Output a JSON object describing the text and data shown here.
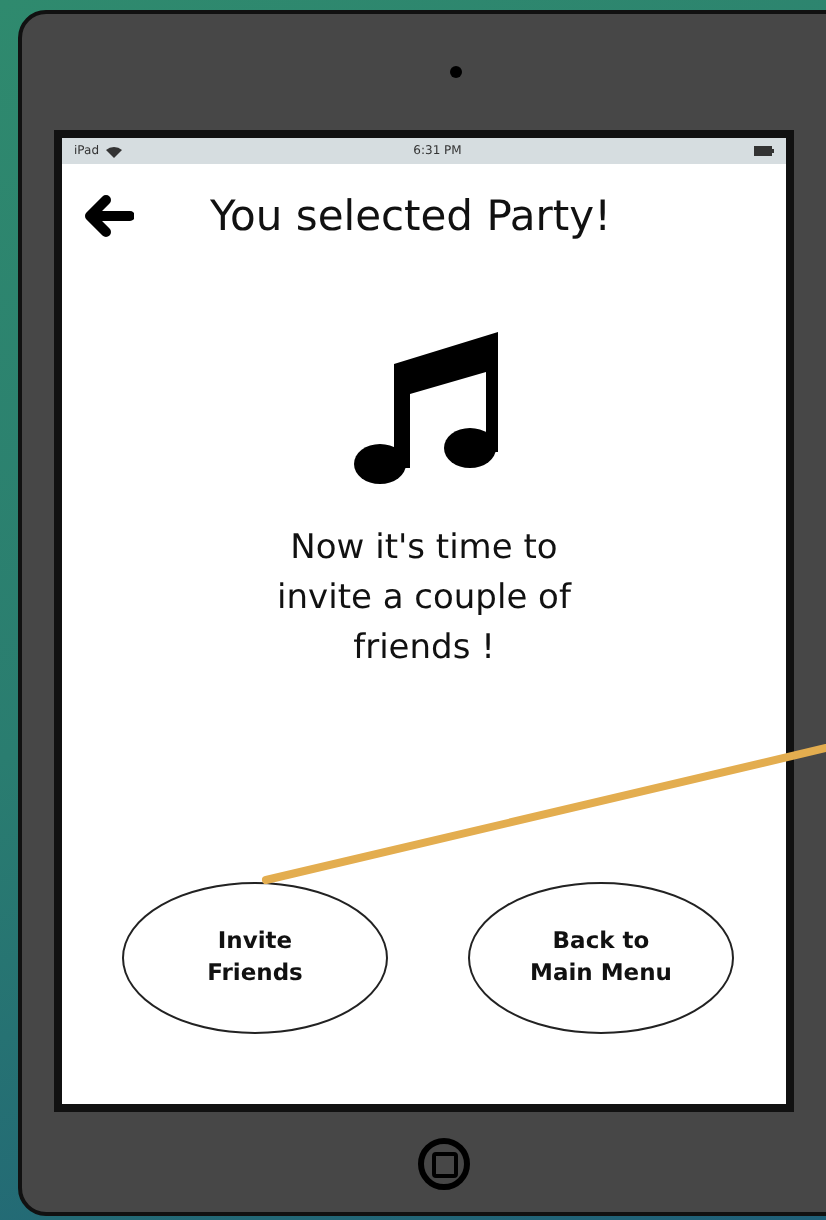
{
  "status_bar": {
    "device": "iPad",
    "time": "6:31 PM"
  },
  "screen": {
    "title": "You selected Party!",
    "message": "Now it's time to invite a couple of friends !"
  },
  "buttons": [
    {
      "label": "Invite Friends",
      "connected": true
    },
    {
      "label": "Back to Main Menu",
      "connected": false
    }
  ]
}
